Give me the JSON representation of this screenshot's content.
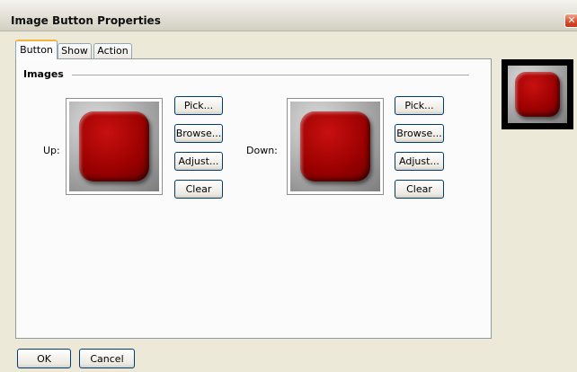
{
  "window": {
    "title": "Image Button Properties",
    "close": "✕"
  },
  "tabs": [
    {
      "label": "Button",
      "active": true
    },
    {
      "label": "Show",
      "active": false
    },
    {
      "label": "Action",
      "active": false
    }
  ],
  "images_group": {
    "title": "Images",
    "up": {
      "label": "Up:"
    },
    "down": {
      "label": "Down:"
    },
    "buttons": {
      "pick": "Pick...",
      "browse": "Browse...",
      "adjust": "Adjust...",
      "clear": "Clear"
    }
  },
  "footer": {
    "ok": "OK",
    "cancel": "Cancel"
  },
  "colors": {
    "button_red": "#a00000",
    "tab_highlight": "#f5b33c",
    "dialog_bg": "#ece9d8"
  }
}
